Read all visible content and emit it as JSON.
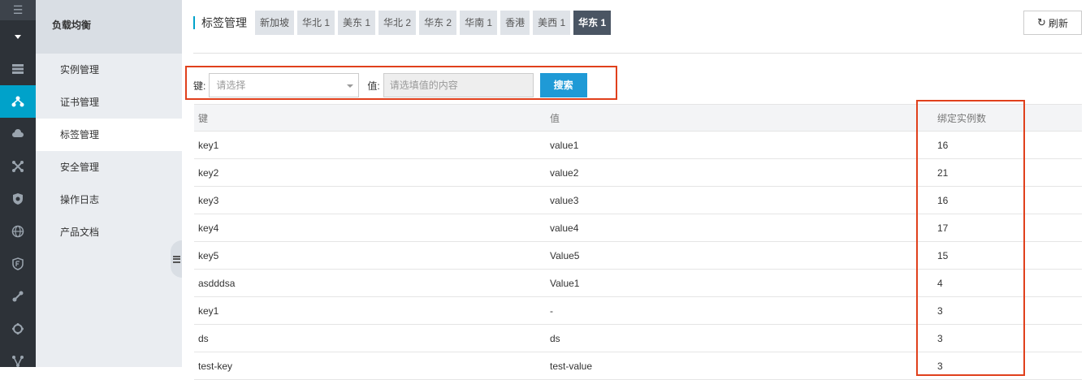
{
  "rail": {
    "icons": [
      "menu-icon",
      "dropdown-icon",
      "server-icon",
      "load-balancer-icon",
      "cloud-icon",
      "network-icon",
      "shield-icon",
      "globe-icon",
      "security-icon",
      "link-icon",
      "hexagon-icon",
      "topology-icon"
    ]
  },
  "subnav": {
    "title": "负载均衡",
    "items": [
      {
        "label": "实例管理"
      },
      {
        "label": "证书管理"
      },
      {
        "label": "标签管理"
      },
      {
        "label": "安全管理"
      },
      {
        "label": "操作日志"
      },
      {
        "label": "产品文档"
      }
    ]
  },
  "header": {
    "title": "标签管理",
    "regions": [
      "新加坡",
      "华北 1",
      "美东 1",
      "华北 2",
      "华东 2",
      "华南 1",
      "香港",
      "美西 1",
      "华东 1"
    ],
    "active_region": "华东 1",
    "refresh_label": "刷新"
  },
  "search": {
    "key_label": "键:",
    "key_placeholder": "请选择",
    "value_label": "值:",
    "value_placeholder": "请选填值的内容",
    "button_label": "搜索"
  },
  "table": {
    "columns": [
      "键",
      "值",
      "绑定实例数"
    ],
    "rows": [
      [
        "key1",
        "value1",
        "16"
      ],
      [
        "key2",
        "value2",
        "21"
      ],
      [
        "key3",
        "value3",
        "16"
      ],
      [
        "key4",
        "value4",
        "17"
      ],
      [
        "key5",
        "Value5",
        "15"
      ],
      [
        "asdddsa",
        "Value1",
        "4"
      ],
      [
        "key1",
        "-",
        "3"
      ],
      [
        "ds",
        "ds",
        "3"
      ],
      [
        "test-key",
        "test-value",
        "3"
      ]
    ]
  },
  "colors": {
    "rail_bg": "#2d3238",
    "accent": "#00a2ca",
    "highlight_border": "#e0401c",
    "search_button": "#1f9ad6",
    "active_region": "#4a5563"
  }
}
